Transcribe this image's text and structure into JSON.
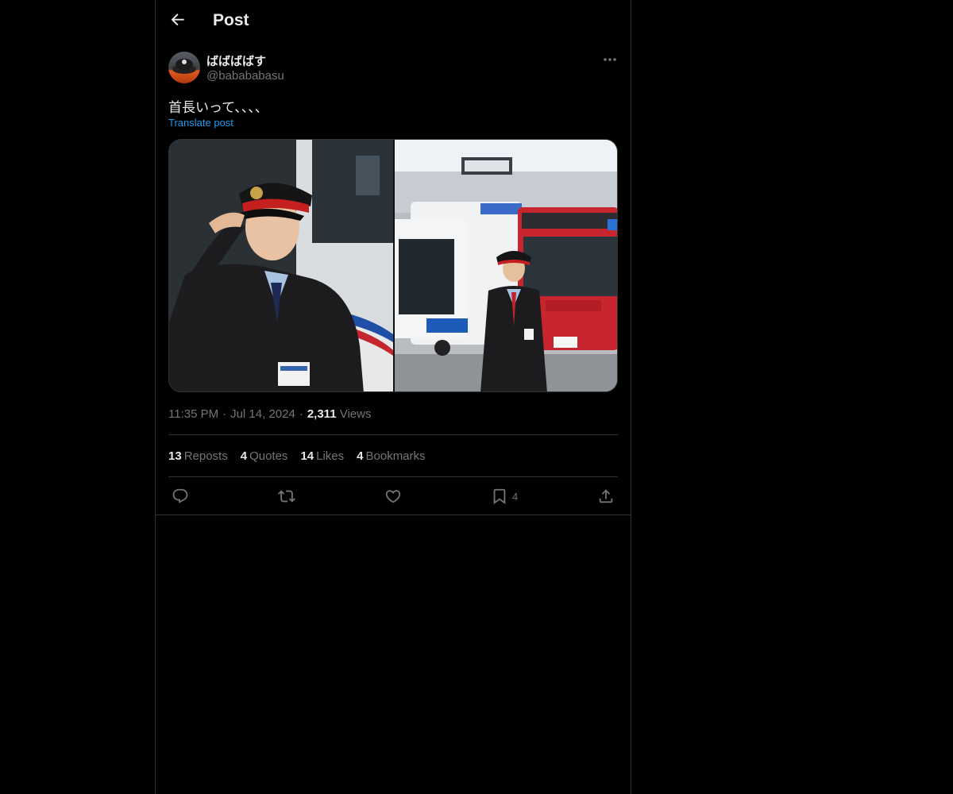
{
  "header": {
    "title": "Post",
    "back_icon": "arrow-left-icon"
  },
  "author": {
    "display_name": "ばばばばす",
    "handle": "@babababasu",
    "avatar_icon": "avatar-image"
  },
  "post": {
    "text": "首長いって、、、、",
    "translate_label": "Translate post",
    "images": [
      {
        "name": "photo-left",
        "description_icon": "photo"
      },
      {
        "name": "photo-right",
        "description_icon": "photo"
      }
    ]
  },
  "meta": {
    "time": "11:35 PM",
    "date": "Jul 14, 2024",
    "views_count": "2,311",
    "views_label": "Views"
  },
  "stats": {
    "reposts_count": "13",
    "reposts_label": "Reposts",
    "quotes_count": "4",
    "quotes_label": "Quotes",
    "likes_count": "14",
    "likes_label": "Likes",
    "bookmarks_count": "4",
    "bookmarks_label": "Bookmarks"
  },
  "actions": {
    "reply_icon": "reply-icon",
    "repost_icon": "repost-icon",
    "like_icon": "heart-icon",
    "bookmark_icon": "bookmark-icon",
    "bookmark_count": "4",
    "share_icon": "share-icon"
  },
  "colors": {
    "background": "#000000",
    "text": "#e7e9ea",
    "secondary_text": "#71767b",
    "accent": "#1d9bf0",
    "border": "#2f3336"
  }
}
